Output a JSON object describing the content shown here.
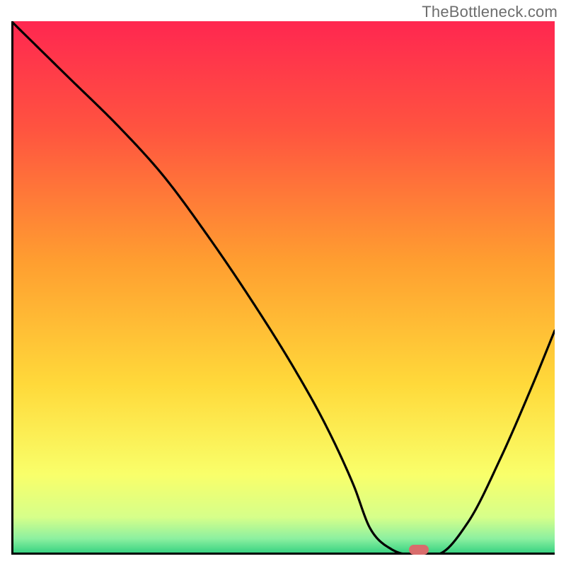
{
  "watermark": "TheBottleneck.com",
  "chart_data": {
    "type": "line",
    "title": "",
    "xlabel": "",
    "ylabel": "",
    "xlim": [
      0,
      100
    ],
    "ylim": [
      0,
      100
    ],
    "x": [
      0,
      10,
      20,
      28,
      36,
      44,
      52,
      58,
      63,
      66,
      70,
      74,
      78,
      84,
      90,
      96,
      100
    ],
    "values": [
      100,
      90,
      80,
      71,
      60,
      48,
      35,
      24,
      13,
      5,
      1,
      0,
      0,
      6,
      18,
      32,
      42
    ],
    "marker": {
      "x": 75,
      "y": 0
    },
    "gradient_stops": [
      {
        "offset": 0.0,
        "color": "#ff2750"
      },
      {
        "offset": 0.2,
        "color": "#ff5340"
      },
      {
        "offset": 0.45,
        "color": "#ff9e30"
      },
      {
        "offset": 0.68,
        "color": "#ffd93a"
      },
      {
        "offset": 0.85,
        "color": "#f9ff6a"
      },
      {
        "offset": 0.93,
        "color": "#d6ff8a"
      },
      {
        "offset": 0.97,
        "color": "#8cf0a0"
      },
      {
        "offset": 1.0,
        "color": "#2ecf7e"
      }
    ]
  }
}
